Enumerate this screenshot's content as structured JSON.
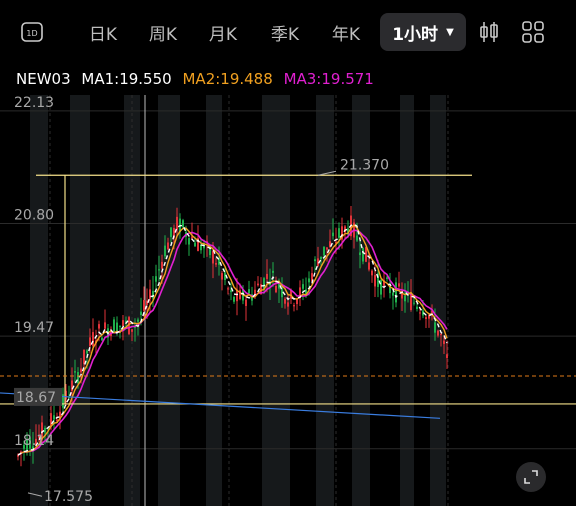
{
  "toolbar": {
    "interval_icon_label": "1D",
    "tabs": [
      {
        "label": "日K"
      },
      {
        "label": "周K"
      },
      {
        "label": "月K"
      },
      {
        "label": "季K"
      },
      {
        "label": "年K"
      }
    ],
    "active_interval": "1小时",
    "candle_icon": "candlestick-icon",
    "grid_icon": "grid-icon"
  },
  "legend": {
    "symbol": "NEW03",
    "ma1": "MA1:19.550",
    "ma2": "MA2:19.488",
    "ma3": "MA3:19.571",
    "colors": {
      "ma1": "#ffffff",
      "ma2": "#f0a020",
      "ma3": "#e020d0"
    }
  },
  "chart_data": {
    "type": "candlestick",
    "y_ticks": [
      "22.13",
      "20.80",
      "19.47",
      "18.14"
    ],
    "ylim": [
      17.5,
      22.2
    ],
    "high_label": "21.370",
    "low_label": "17.575",
    "current_price_label": "18.67",
    "support_level": 18.67,
    "resistance_level": 21.37,
    "colors": {
      "up": "#e2343a",
      "down": "#1fb14c",
      "current_line": "#e07a18",
      "level_line": "#f4e08a",
      "trend_line": "#3a7de0"
    }
  },
  "expand_icon": "expand-icon"
}
